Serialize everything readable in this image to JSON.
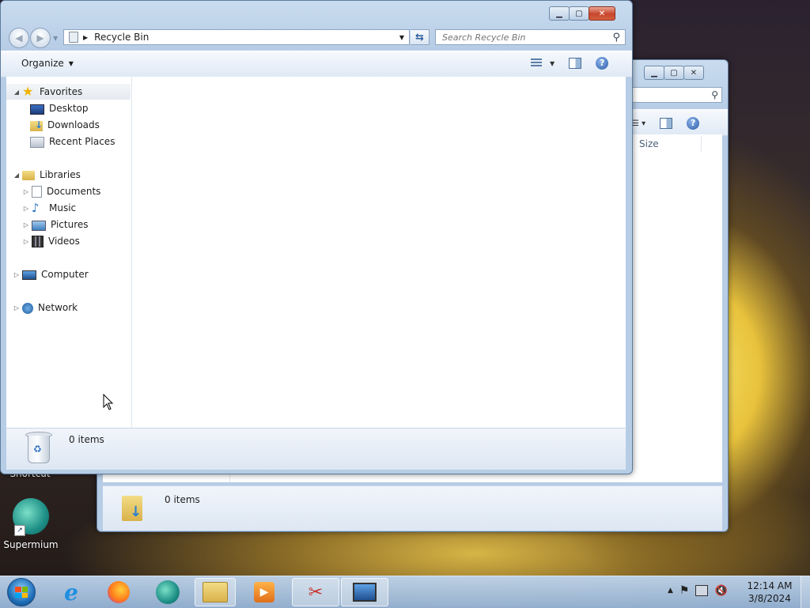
{
  "desktop": {
    "icons": [
      {
        "label": "Shortcut"
      },
      {
        "label": "Supermium"
      }
    ]
  },
  "back_window": {
    "column_size": "Size",
    "status_count": "0 items"
  },
  "front_window": {
    "address": {
      "location": "Recycle Bin",
      "search_placeholder": "Search Recycle Bin"
    },
    "toolbar": {
      "organize_label": "Organize"
    },
    "nav": {
      "favorites": {
        "label": "Favorites",
        "items": [
          "Desktop",
          "Downloads",
          "Recent Places"
        ]
      },
      "libraries": {
        "label": "Libraries",
        "items": [
          "Documents",
          "Music",
          "Pictures",
          "Videos"
        ]
      },
      "computer": "Computer",
      "network": "Network"
    },
    "status": {
      "count": "0 items"
    }
  },
  "taskbar": {
    "clock_time": "12:14 AM",
    "clock_date": "3/8/2024"
  },
  "colors": {
    "accent": "#3a6ea5",
    "close_red": "#c8452c"
  }
}
